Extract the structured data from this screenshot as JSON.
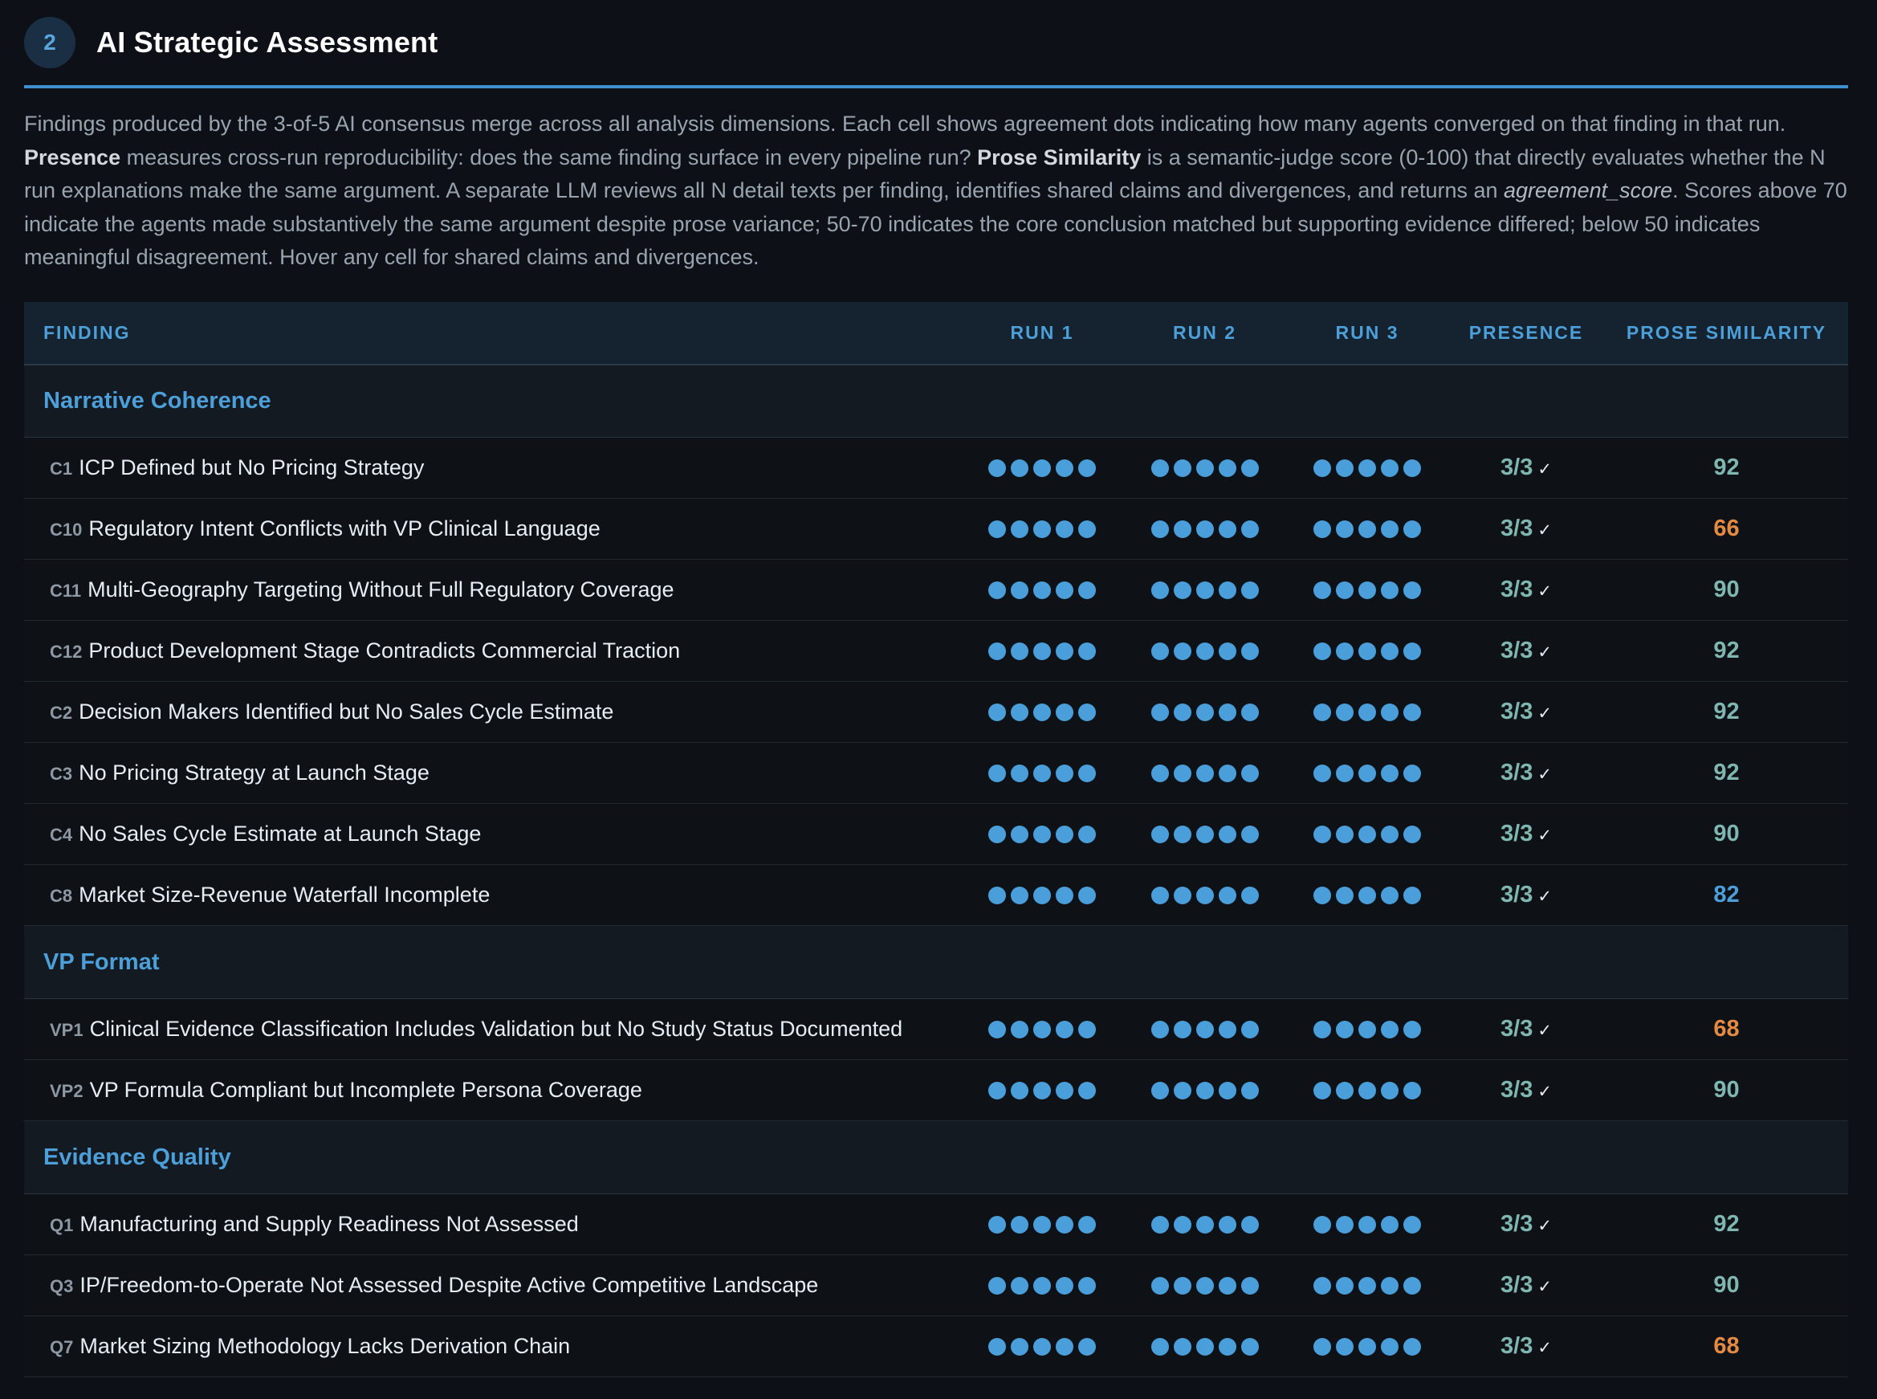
{
  "section": {
    "number": "2",
    "title": "AI Strategic Assessment"
  },
  "description": {
    "p1": "Findings produced by the 3-of-5 AI consensus merge across all analysis dimensions. Each cell shows agreement dots indicating how many agents converged on that finding in that run. ",
    "presence_label": "Presence",
    "p2": " measures cross-run reproducibility: does the same finding surface in every pipeline run? ",
    "prose_label": "Prose Similarity",
    "p3": " is a semantic-judge score (0-100) that directly evaluates whether the N run explanations make the same argument. A separate LLM reviews all N detail texts per finding, identifies shared claims and divergences, and returns an ",
    "score_term": "agreement_score",
    "p4": ". Scores above 70 indicate the agents made substantively the same argument despite prose variance; 50-70 indicates the core conclusion matched but supporting evidence differed; below 50 indicates meaningful disagreement. Hover any cell for shared claims and divergences."
  },
  "table": {
    "headers": [
      "FINDING",
      "RUN 1",
      "RUN 2",
      "RUN 3",
      "PRESENCE",
      "PROSE SIMILARITY"
    ],
    "colors": {
      "high": "#7fb7b0",
      "mid": "#e58a42",
      "blue": "#4d9fd9"
    },
    "groups": [
      {
        "name": "Narrative Coherence",
        "rows": [
          {
            "code": "C1",
            "title": "ICP Defined but No Pricing Strategy",
            "runs": [
              5,
              5,
              5
            ],
            "presence": "3/3",
            "similarity": "92",
            "level": "high"
          },
          {
            "code": "C10",
            "title": "Regulatory Intent Conflicts with VP Clinical Language",
            "runs": [
              5,
              5,
              5
            ],
            "presence": "3/3",
            "similarity": "66",
            "level": "mid"
          },
          {
            "code": "C11",
            "title": "Multi-Geography Targeting Without Full Regulatory Coverage",
            "runs": [
              5,
              5,
              5
            ],
            "presence": "3/3",
            "similarity": "90",
            "level": "high"
          },
          {
            "code": "C12",
            "title": "Product Development Stage Contradicts Commercial Traction",
            "runs": [
              5,
              5,
              5
            ],
            "presence": "3/3",
            "similarity": "92",
            "level": "high"
          },
          {
            "code": "C2",
            "title": "Decision Makers Identified but No Sales Cycle Estimate",
            "runs": [
              5,
              5,
              5
            ],
            "presence": "3/3",
            "similarity": "92",
            "level": "high"
          },
          {
            "code": "C3",
            "title": "No Pricing Strategy at Launch Stage",
            "runs": [
              5,
              5,
              5
            ],
            "presence": "3/3",
            "similarity": "92",
            "level": "high"
          },
          {
            "code": "C4",
            "title": "No Sales Cycle Estimate at Launch Stage",
            "runs": [
              5,
              5,
              5
            ],
            "presence": "3/3",
            "similarity": "90",
            "level": "high"
          },
          {
            "code": "C8",
            "title": "Market Size-Revenue Waterfall Incomplete",
            "runs": [
              5,
              5,
              5
            ],
            "presence": "3/3",
            "similarity": "82",
            "level": "blue"
          }
        ]
      },
      {
        "name": "VP Format",
        "rows": [
          {
            "code": "VP1",
            "title": "Clinical Evidence Classification Includes Validation but No Study Status Documented",
            "runs": [
              5,
              5,
              5
            ],
            "presence": "3/3",
            "similarity": "68",
            "level": "mid"
          },
          {
            "code": "VP2",
            "title": "VP Formula Compliant but Incomplete Persona Coverage",
            "runs": [
              5,
              5,
              5
            ],
            "presence": "3/3",
            "similarity": "90",
            "level": "high"
          }
        ]
      },
      {
        "name": "Evidence Quality",
        "rows": [
          {
            "code": "Q1",
            "title": "Manufacturing and Supply Readiness Not Assessed",
            "runs": [
              5,
              5,
              5
            ],
            "presence": "3/3",
            "similarity": "92",
            "level": "high"
          },
          {
            "code": "Q3",
            "title": "IP/Freedom-to-Operate Not Assessed Despite Active Competitive Landscape",
            "runs": [
              5,
              5,
              5
            ],
            "presence": "3/3",
            "similarity": "90",
            "level": "high"
          },
          {
            "code": "Q7",
            "title": "Market Sizing Methodology Lacks Derivation Chain",
            "runs": [
              5,
              5,
              5
            ],
            "presence": "3/3",
            "similarity": "68",
            "level": "mid"
          }
        ]
      }
    ]
  }
}
